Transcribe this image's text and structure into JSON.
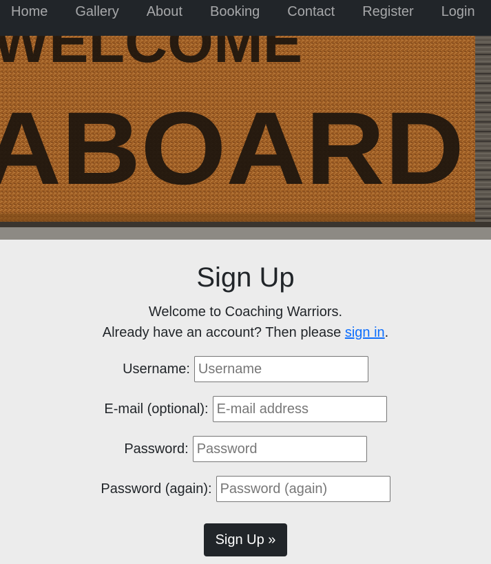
{
  "nav": {
    "items": [
      "Home",
      "Gallery",
      "About",
      "Booking",
      "Contact",
      "Register",
      "Login"
    ]
  },
  "hero": {
    "mat_text_top": "WELCOME",
    "mat_text_bottom": "ABOARD"
  },
  "main": {
    "title": "Sign Up",
    "welcome": "Welcome to Coaching Warriors.",
    "signin_prefix": "Already have an account? Then please ",
    "signin_link": "sign in",
    "signin_suffix": "."
  },
  "form": {
    "username_label": "Username:",
    "username_placeholder": "Username",
    "email_label": "E-mail (optional):",
    "email_placeholder": "E-mail address",
    "password_label": "Password:",
    "password_placeholder": "Password",
    "password2_label": "Password (again):",
    "password2_placeholder": "Password (again)",
    "submit_label": "Sign Up »"
  },
  "colors": {
    "navbar": "#212529",
    "background": "#ececec",
    "link": "#0d6efd",
    "button": "#212529"
  }
}
